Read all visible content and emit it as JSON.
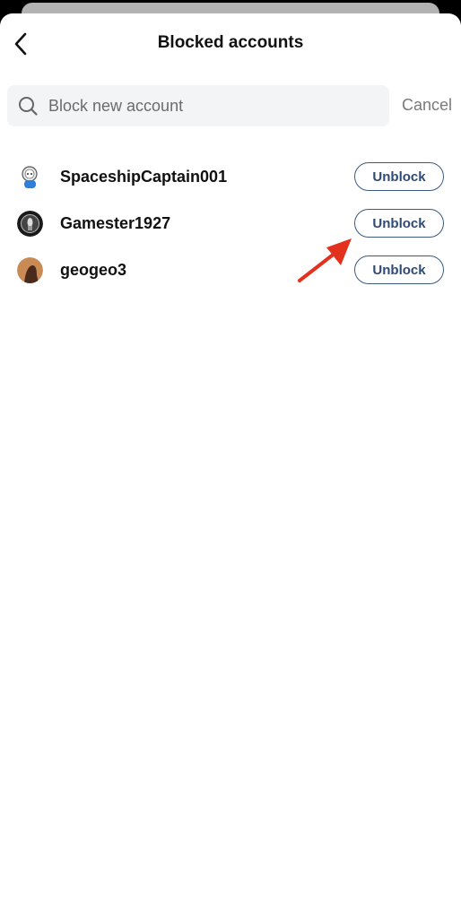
{
  "header": {
    "title": "Blocked accounts",
    "back_icon": "chevron-left-icon"
  },
  "search": {
    "placeholder": "Block new account",
    "value": "",
    "cancel_label": "Cancel",
    "icon": "search-icon"
  },
  "blocked_accounts": [
    {
      "username": "SpaceshipCaptain001",
      "action_label": "Unblock",
      "avatar": "snoo-astronaut-avatar"
    },
    {
      "username": "Gamester1927",
      "action_label": "Unblock",
      "avatar": "dark-circular-avatar"
    },
    {
      "username": "geogeo3",
      "action_label": "Unblock",
      "avatar": "brown-photo-avatar"
    }
  ],
  "annotation": {
    "type": "red-arrow",
    "color": "#e2321d",
    "points_to": "Gamester1927 Unblock button"
  },
  "colors": {
    "button_border": "#3d5a80",
    "button_text": "#2e4a75",
    "search_bg": "#f3f4f6"
  }
}
